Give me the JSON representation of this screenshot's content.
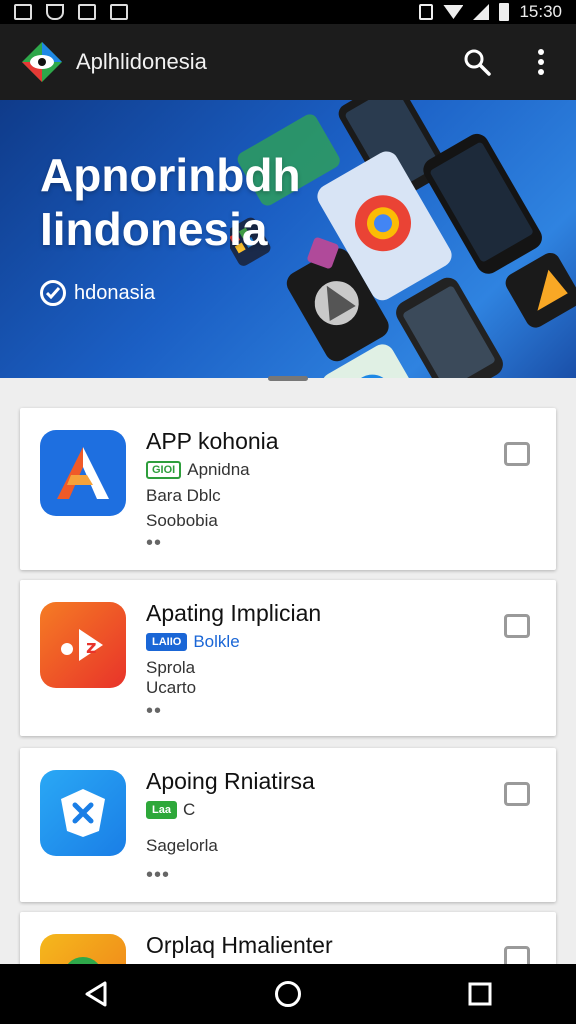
{
  "status_bar": {
    "time": "15:30",
    "left_icons": [
      "image-icon",
      "shield-icon",
      "photo-icon",
      "calendar-icon"
    ],
    "right_icons": [
      "vibrate-icon",
      "wifi-icon",
      "signal-icon",
      "battery-icon"
    ]
  },
  "app_bar": {
    "title": "Aplhlidonesia",
    "logo_icon": "app-logo-icon",
    "actions": [
      "search-icon",
      "more-vert-icon"
    ]
  },
  "hero": {
    "title_line1": "Apnorinbdh",
    "title_line2": "Iindonesia",
    "badge_text": "hdonasia",
    "badge_icon": "check-circle-icon"
  },
  "apps": [
    {
      "title": "APP kohonia",
      "tag": "GIOI",
      "tag_color": "#2e9e3c",
      "subtitle": "Apnidna",
      "line1": "Bara Dblc",
      "line2": "Soobobia",
      "icon_bg": "#1e6fe0",
      "icon_name": "letter-a-icon",
      "checked": false
    },
    {
      "title": "Apating Implician",
      "tag": "LAIIO",
      "tag_color": "#1a66d6",
      "subtitle": "Bolkle",
      "line1": "Sprola",
      "line2": "Ucarto",
      "icon_bg": "#f0542a",
      "icon_name": "play-music-icon",
      "checked": false
    },
    {
      "title": "Apoing Rniatirsa",
      "tag": "Laa",
      "tag_color": "#2ea83a",
      "subtitle": "C",
      "line1": "Sagelorla",
      "line2": "",
      "icon_bg": "#1f8ff0",
      "icon_name": "shield-x-icon",
      "checked": false
    },
    {
      "title": "Orplaq Hmalienter",
      "icon_bg": "#f29a1c",
      "icon_name": "circle-app-icon",
      "checked": false
    }
  ],
  "nav_bar": {
    "buttons": [
      "back-icon",
      "home-icon",
      "recents-icon"
    ]
  },
  "colors": {
    "app_bar_bg": "#1c1c1c",
    "hero_blue": "#1b5fc4",
    "page_bg": "#eeeeee",
    "card_bg": "#ffffff"
  }
}
